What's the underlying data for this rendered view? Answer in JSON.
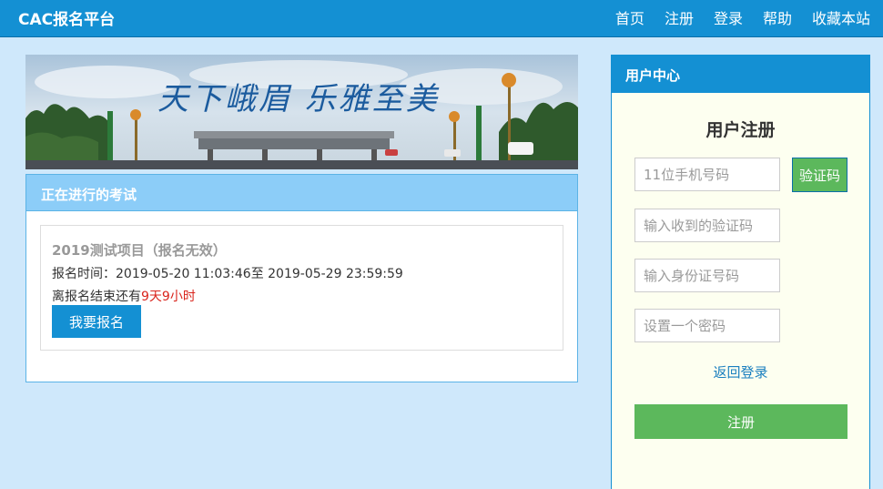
{
  "header": {
    "brand": "CAC报名平台",
    "nav": [
      "首页",
      "注册",
      "登录",
      "帮助",
      "收藏本站"
    ]
  },
  "banner": {
    "slogan": "天下峨眉 乐雅至美"
  },
  "exam_panel": {
    "title": "正在进行的考试",
    "exam": {
      "name": "2019测试项目（报名无效）",
      "time_label": "报名时间：",
      "time_value": "2019-05-20 11:03:46至 2019-05-29 23:59:59",
      "remain_prefix": "离报名结束还有",
      "remain_value": "9天9小时",
      "apply_label": "我要报名"
    }
  },
  "user_panel": {
    "title": "用户中心",
    "form_title": "用户注册",
    "phone_placeholder": "11位手机号码",
    "code_button": "验证码",
    "code_placeholder": "输入收到的验证码",
    "id_placeholder": "输入身份证号码",
    "password_placeholder": "设置一个密码",
    "back_link": "返回登录",
    "submit_label": "注册"
  },
  "colors": {
    "primary": "#1490d3",
    "success": "#5cb85c",
    "page_bg": "#cfe8fb",
    "highlight": "#d9241c"
  }
}
